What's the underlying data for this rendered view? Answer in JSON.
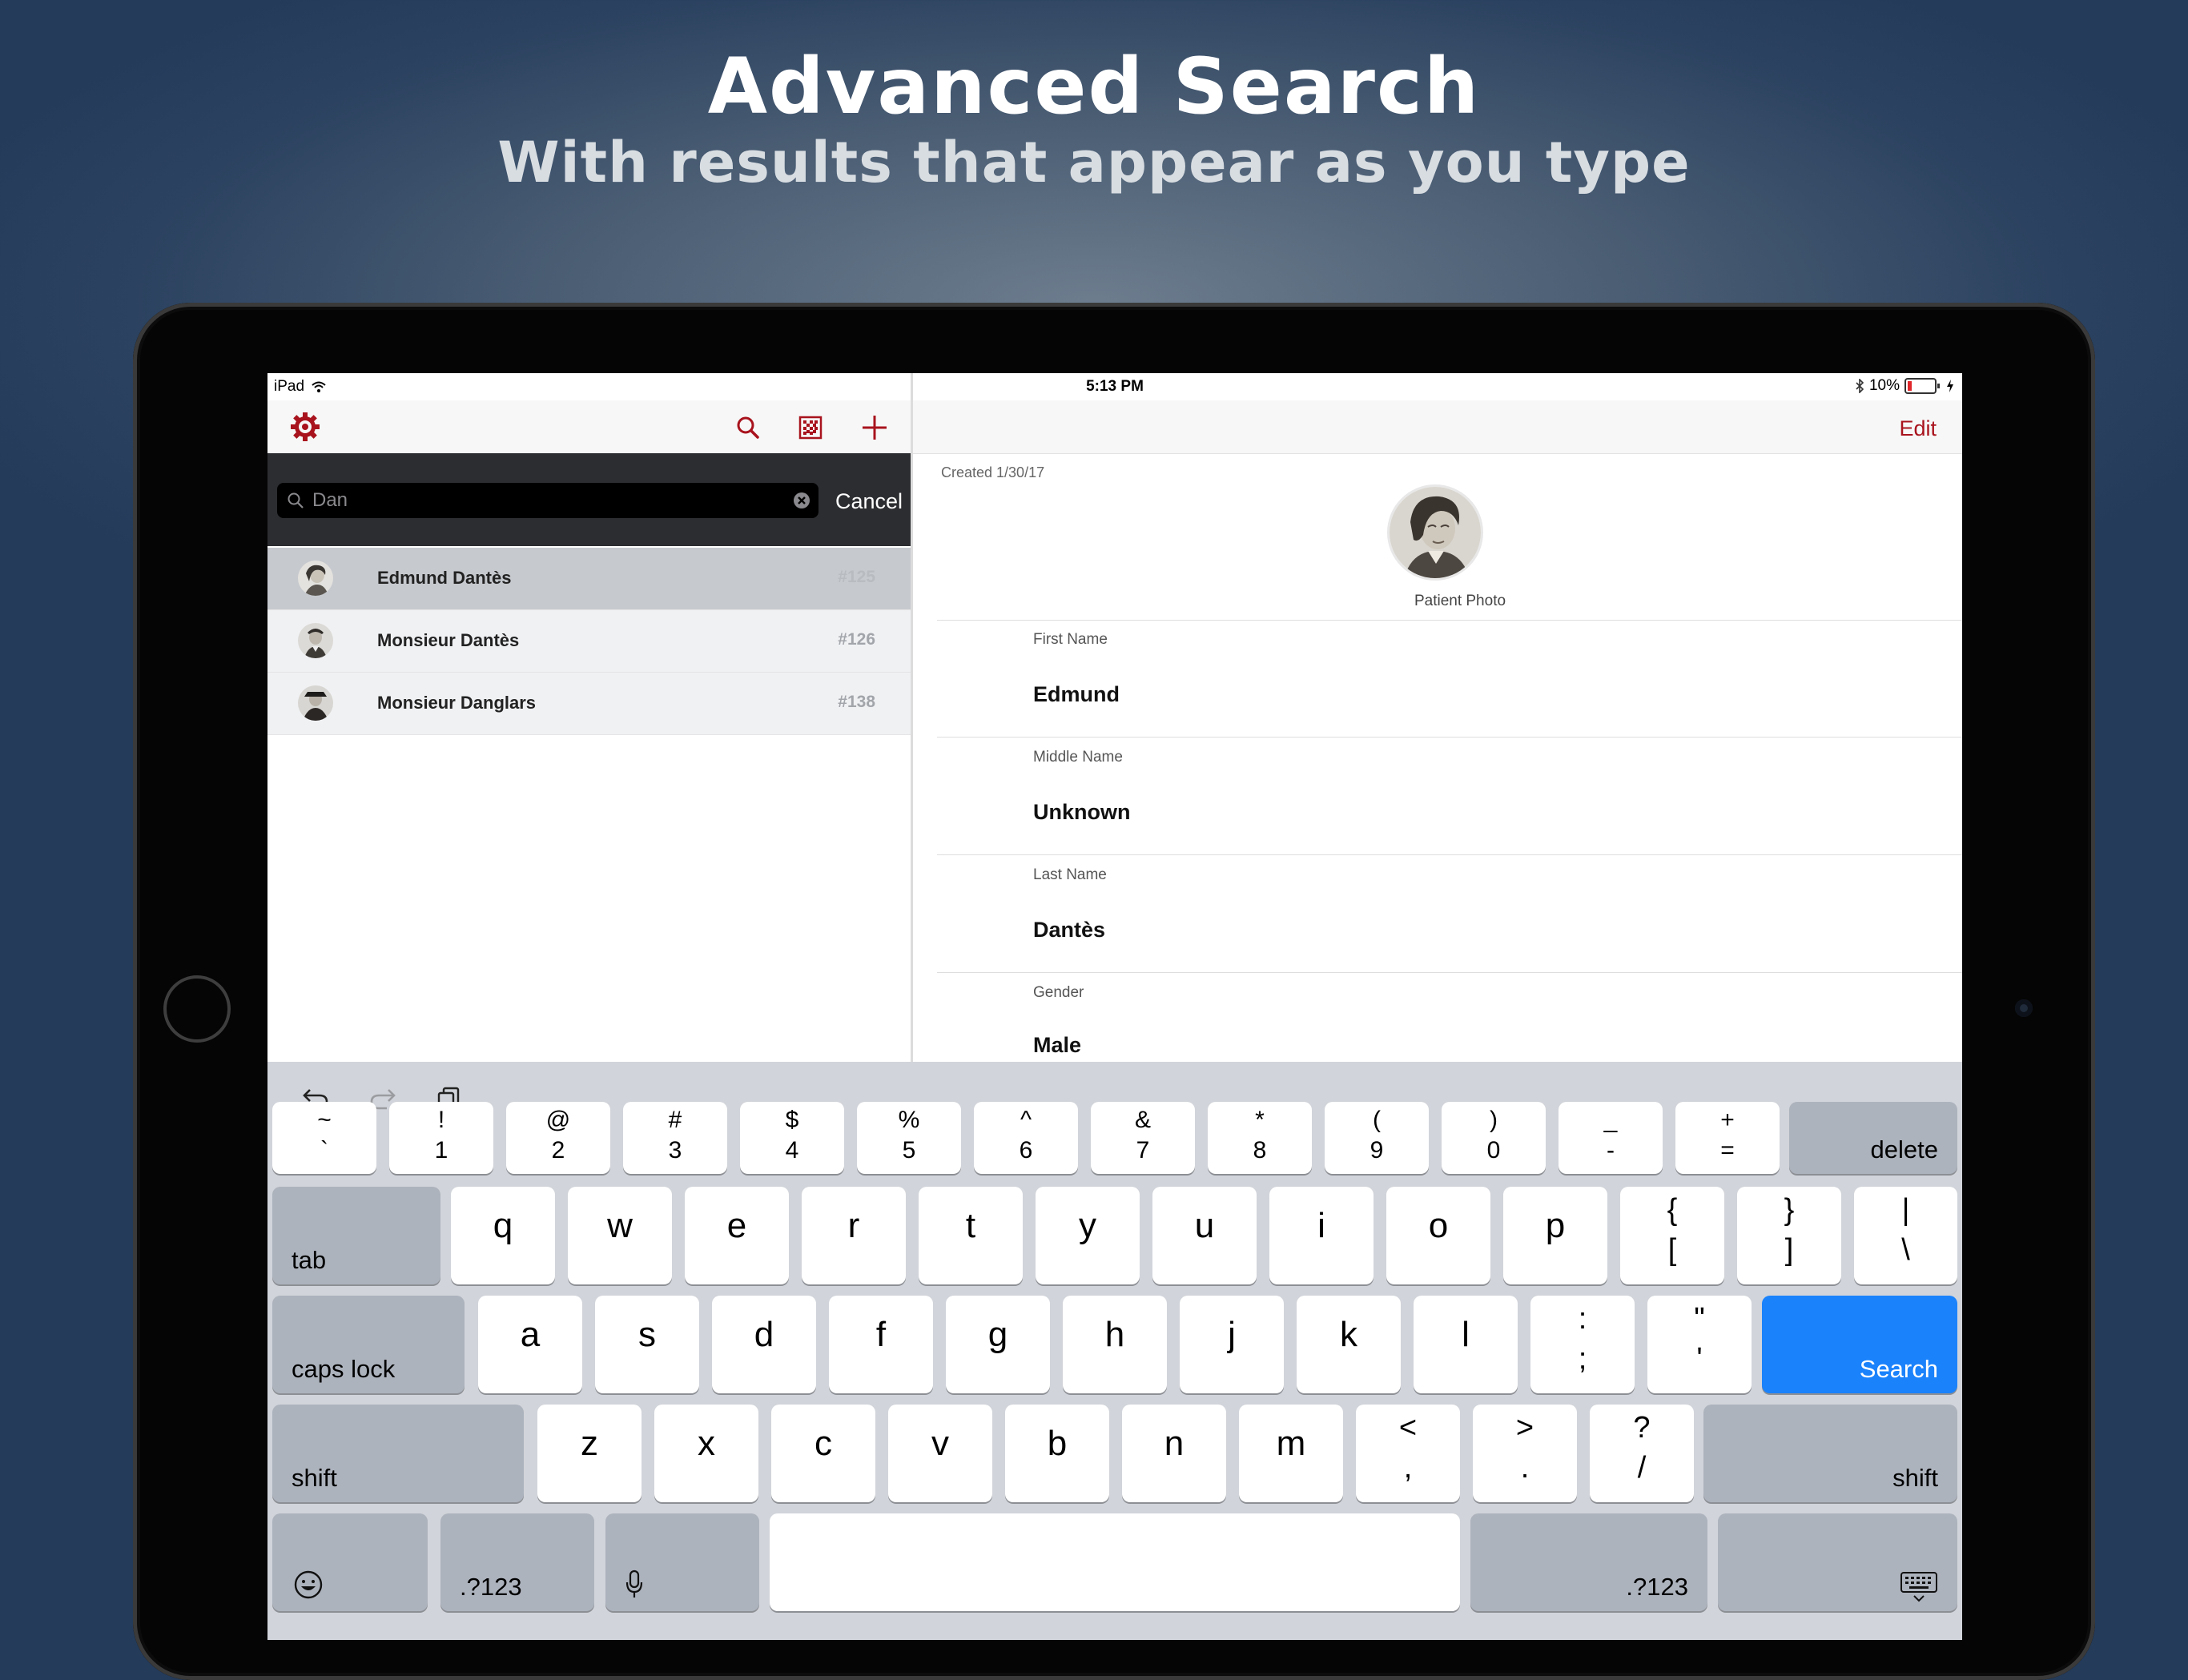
{
  "header": {
    "title": "Advanced Search",
    "subtitle": "With results that appear as you type"
  },
  "status_bar": {
    "device": "iPad",
    "time": "5:13 PM",
    "battery": "10%"
  },
  "sidebar": {
    "search_value": "Dan",
    "cancel_label": "Cancel",
    "results": [
      {
        "name": "Edmund Dantès",
        "id": "#125",
        "selected": true
      },
      {
        "name": "Monsieur Dantès",
        "id": "#126",
        "selected": false
      },
      {
        "name": "Monsieur Danglars",
        "id": "#138",
        "selected": false
      }
    ]
  },
  "detail": {
    "edit_label": "Edit",
    "created": "Created 1/30/17",
    "photo_label": "Patient Photo",
    "fields": [
      {
        "label": "First Name",
        "value": "Edmund"
      },
      {
        "label": "Middle Name",
        "value": "Unknown"
      },
      {
        "label": "Last Name",
        "value": "Dantès"
      },
      {
        "label": "Gender",
        "value": "Male"
      }
    ]
  },
  "keyboard": {
    "row1": [
      [
        "~",
        "`"
      ],
      [
        "!",
        "1"
      ],
      [
        "@",
        "2"
      ],
      [
        "#",
        "3"
      ],
      [
        "$",
        "4"
      ],
      [
        "%",
        "5"
      ],
      [
        "^",
        "6"
      ],
      [
        "&",
        "7"
      ],
      [
        "*",
        "8"
      ],
      [
        "(",
        "9"
      ],
      [
        ")",
        "0"
      ],
      [
        "_",
        "-"
      ],
      [
        "+",
        "="
      ]
    ],
    "delete": "delete",
    "tab": "tab",
    "row2": [
      "q",
      "w",
      "e",
      "r",
      "t",
      "y",
      "u",
      "i",
      "o",
      "p"
    ],
    "row2_sym": [
      [
        "{",
        "["
      ],
      [
        "}",
        "]"
      ],
      [
        "|",
        "\\"
      ]
    ],
    "caps_lock": "caps lock",
    "row3": [
      "a",
      "s",
      "d",
      "f",
      "g",
      "h",
      "j",
      "k",
      "l"
    ],
    "row3_sym": [
      [
        ":",
        ";"
      ],
      [
        "\"",
        "'"
      ]
    ],
    "search": "Search",
    "shift": "shift",
    "row4": [
      "z",
      "x",
      "c",
      "v",
      "b",
      "n",
      "m"
    ],
    "row4_sym": [
      [
        "<",
        ","
      ],
      [
        ">",
        "."
      ],
      [
        "?",
        "/"
      ]
    ],
    "numbers": ".?123"
  },
  "colors": {
    "accent": "#a8131d",
    "search_key": "#1a82fb"
  }
}
